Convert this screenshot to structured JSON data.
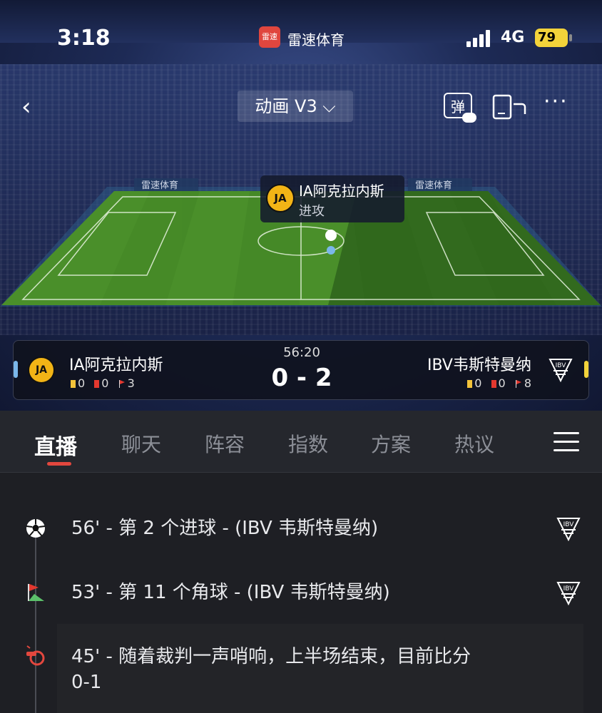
{
  "status_bar": {
    "time": "3:18",
    "app_badge": "雷速",
    "app_name": "雷速体育",
    "network": "4G",
    "battery": "79"
  },
  "toolbar": {
    "back_icon": "back-chevron-icon",
    "mode_label": "动画 V3",
    "danmu_label": "弹",
    "more_label": "···"
  },
  "field": {
    "ad_text": "雷速体育",
    "tooltip": {
      "team": "IA阿克拉内斯",
      "action": "进攻",
      "logo_text": "JA"
    }
  },
  "scoreboard": {
    "clock": "56:20",
    "score": "0 - 2",
    "home": {
      "name": "IA阿克拉内斯",
      "logo_text": "JA",
      "yellow": "0",
      "red": "0",
      "corners": "3"
    },
    "away": {
      "name": "IBV韦斯特曼纳",
      "logo_text": "IBV",
      "yellow": "0",
      "red": "0",
      "corners": "8"
    }
  },
  "tabs": [
    {
      "label": "直播",
      "active": true
    },
    {
      "label": "聊天"
    },
    {
      "label": "阵容"
    },
    {
      "label": "指数"
    },
    {
      "label": "方案"
    },
    {
      "label": "热议"
    }
  ],
  "events": [
    {
      "icon": "soccer-ball-icon",
      "text": "56' - 第 2 个进球 - (IBV 韦斯特曼纳)"
    },
    {
      "icon": "corner-flag-icon",
      "text": "53' - 第 11 个角球 - (IBV 韦斯特曼纳)"
    },
    {
      "icon": "whistle-icon",
      "text_line1": "45' - 随着裁判一声哨响，上半场结束，目前比分",
      "text_line2": "0-1"
    }
  ],
  "colors": {
    "accent_red": "#e3473e",
    "home_color": "#7bb7ea",
    "away_color": "#f3d33a",
    "pitch_green": "#4a8f2a"
  }
}
